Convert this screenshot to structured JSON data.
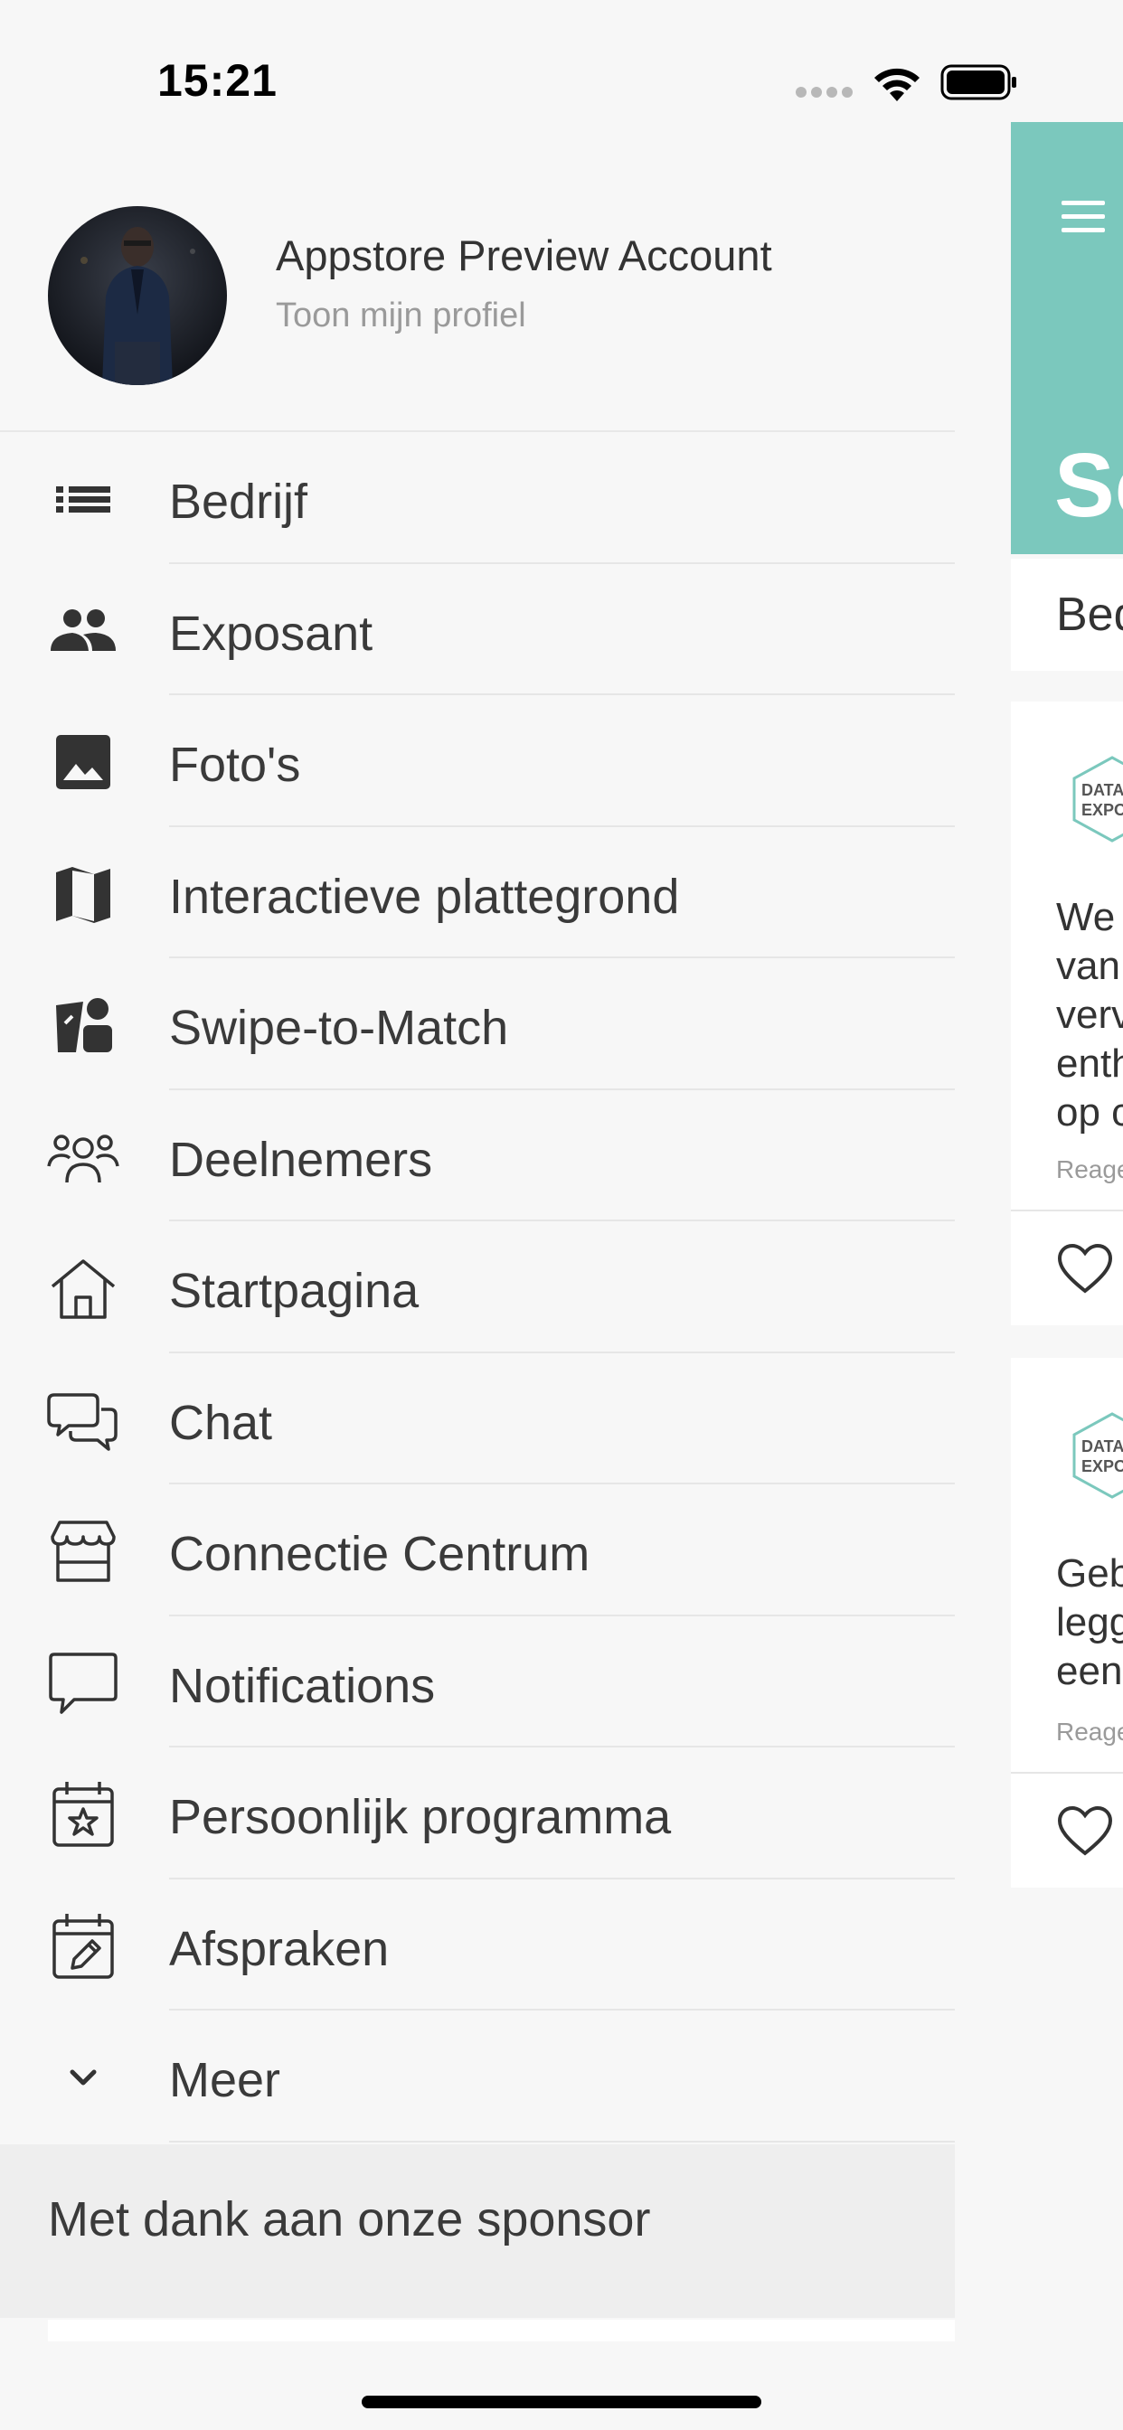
{
  "status_bar": {
    "time": "15:21"
  },
  "profile": {
    "name": "Appstore Preview Account",
    "link": "Toon mijn profiel"
  },
  "menu": [
    {
      "label": "Bedrijf",
      "icon": "list-icon"
    },
    {
      "label": "Exposant",
      "icon": "people-icon"
    },
    {
      "label": "Foto's",
      "icon": "image-icon"
    },
    {
      "label": "Interactieve plattegrond",
      "icon": "map-icon"
    },
    {
      "label": "Swipe-to-Match",
      "icon": "swipe-match-icon"
    },
    {
      "label": "Deelnemers",
      "icon": "participants-icon"
    },
    {
      "label": "Startpagina",
      "icon": "home-icon"
    },
    {
      "label": "Chat",
      "icon": "chat-icon"
    },
    {
      "label": "Connectie Centrum",
      "icon": "store-icon"
    },
    {
      "label": "Notifications",
      "icon": "speech-bubble-icon"
    },
    {
      "label": "Persoonlijk programma",
      "icon": "calendar-star-icon"
    },
    {
      "label": "Afspraken",
      "icon": "calendar-edit-icon"
    },
    {
      "label": "Meer",
      "icon": "chevron-down-icon"
    }
  ],
  "sponsor": {
    "label": "Met dank aan onze sponsor"
  },
  "main": {
    "header_title": "Sc",
    "tab_label": "Bed",
    "cards": [
      {
        "logo_text_1": "DATA",
        "logo_text_2": "EXPO",
        "lines": [
          "We",
          "van",
          "verv",
          "enth",
          "op c"
        ],
        "meta": "Reage"
      },
      {
        "logo_text_1": "DATA",
        "logo_text_2": "EXPO",
        "lines": [
          "Geb",
          "legg",
          "een"
        ],
        "meta": "Reage"
      }
    ]
  },
  "colors": {
    "accent": "#7bc8bd",
    "drawer_bg": "#f7f7f7",
    "sponsor_bg": "#eeeeee",
    "text": "#3a3a3a",
    "muted": "#9a9a9a"
  }
}
